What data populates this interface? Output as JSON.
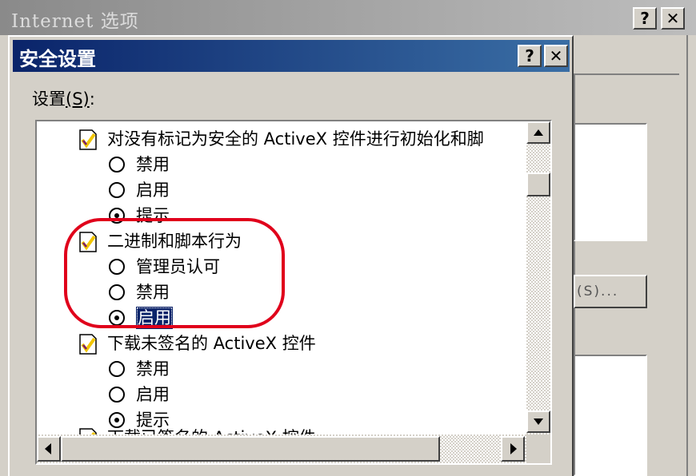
{
  "outer_window": {
    "title": "Internet 选项",
    "side_button_label": "(S)..."
  },
  "dialog": {
    "title": "安全设置",
    "settings_label_prefix": "设置",
    "settings_label_key": "(S)",
    "settings_label_suffix": ":"
  },
  "list": {
    "item1": {
      "label": "对没有标记为安全的 ActiveX 控件进行初始化和脚",
      "options": [
        "禁用",
        "启用",
        "提示"
      ],
      "selected": "提示"
    },
    "item2": {
      "label": "二进制和脚本行为",
      "options": [
        "管理员认可",
        "禁用",
        "启用"
      ],
      "selected": "启用"
    },
    "item3": {
      "label": "下载未签名的 ActiveX 控件",
      "options": [
        "禁用",
        "启用",
        "提示"
      ],
      "selected": "提示"
    },
    "item4": {
      "label": "下载已签名的 ActiveX 控件"
    }
  },
  "annotation": {
    "highlight_color": "#e0001b"
  },
  "colors": {
    "titlebar_active": "#0a246a",
    "face": "#d4d0c8",
    "selection": "#0a246a"
  }
}
